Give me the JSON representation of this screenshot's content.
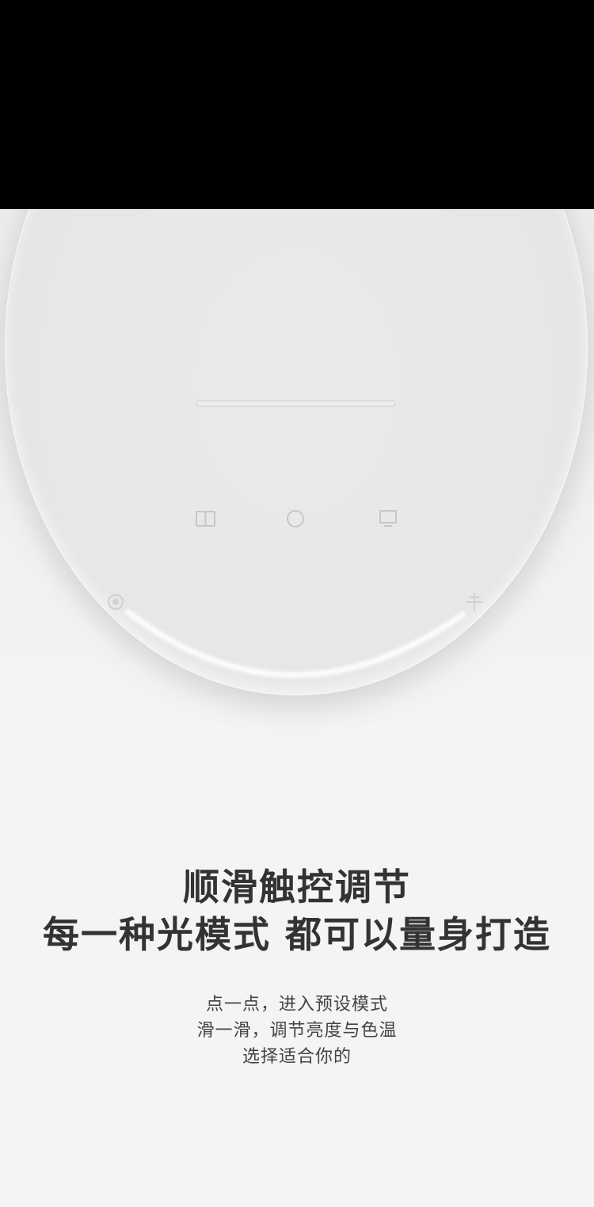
{
  "headline": {
    "line1": "顺滑触控调节",
    "line2": "每一种光模式 都可以量身打造"
  },
  "description": {
    "line1": "点一点，进入预设模式",
    "line2": "滑一滑，调节亮度与色温",
    "line3": "选择适合你的"
  },
  "controls": {
    "left_icon": "book-mode-icon",
    "center_icon": "power-circle-icon",
    "right_icon": "monitor-mode-icon",
    "slider_min_icon": "brightness-low-icon",
    "slider_max_icon": "brightness-high-icon"
  },
  "colors": {
    "top_bar": "#000000",
    "background": "#f4f4f4",
    "lamp_surface": "#e6e7e8",
    "icon_stroke": "#c9cacb",
    "slider_glow": "#ffffff",
    "headline_text": "#333333",
    "body_text": "#444444"
  }
}
